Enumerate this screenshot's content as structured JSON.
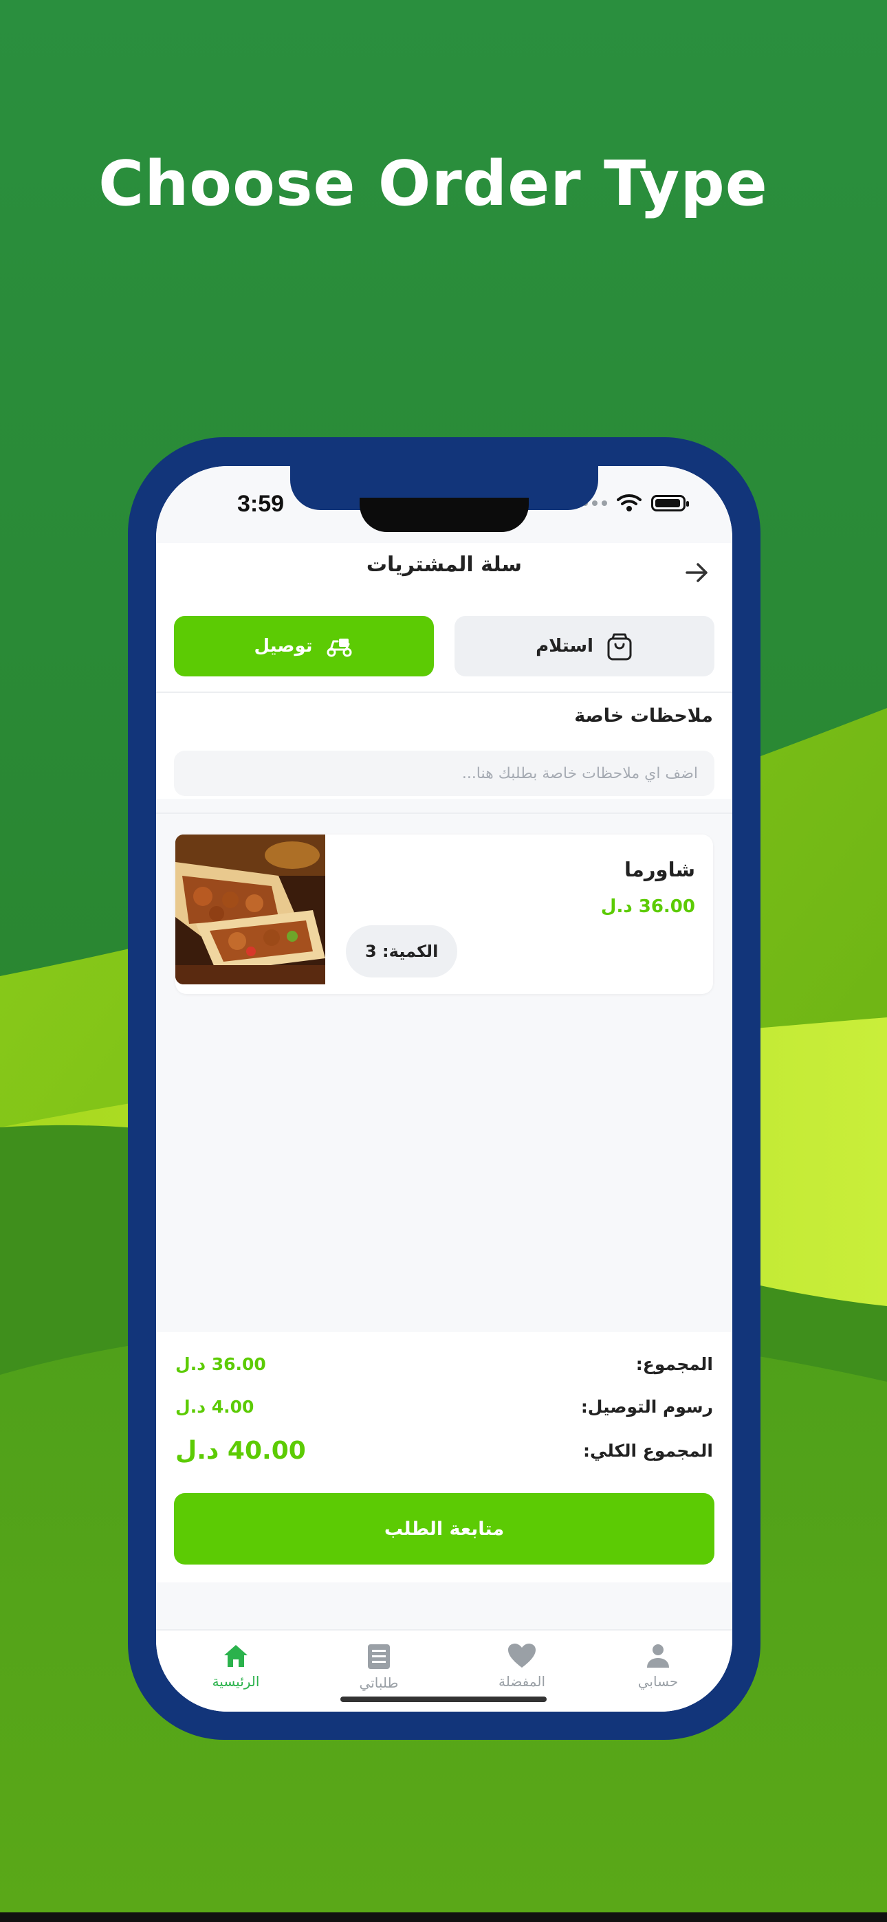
{
  "headline": "Choose Order Type",
  "status_bar": {
    "time": "3:59"
  },
  "header": {
    "title": "سلة المشتريات",
    "back_icon": "arrow-right-icon"
  },
  "order_type": {
    "pickup_label": "استلام",
    "delivery_label": "توصيل",
    "selected": "delivery"
  },
  "notes": {
    "label": "ملاحظات خاصة",
    "placeholder": "اضف اي ملاحظات خاصة بطلبك هنا..."
  },
  "cart_items": [
    {
      "name": "شاورما",
      "price": "36.00 د.ل",
      "quantity": "الكمية: 3"
    }
  ],
  "summary": {
    "subtotal_label": "المجموع:",
    "subtotal_value": "36.00 د.ل",
    "delivery_label": "رسوم التوصيل:",
    "delivery_value": "4.00 د.ل",
    "total_label": "المجموع الكلي:",
    "total_value": "40.00 د.ل"
  },
  "checkout_label": "متابعة الطلب",
  "bottom_nav": [
    {
      "label": "الرئيسية",
      "icon": "home-icon",
      "active": true
    },
    {
      "label": "طلباتي",
      "icon": "orders-list-icon",
      "active": false
    },
    {
      "label": "المفضلة",
      "icon": "heart-icon",
      "active": false
    },
    {
      "label": "حسابي",
      "icon": "user-icon",
      "active": false
    }
  ],
  "colors": {
    "accent": "#5ccb04",
    "phone_frame": "#12357a",
    "background_dark": "#2b8f3c",
    "background_light": "#a8d81a"
  }
}
